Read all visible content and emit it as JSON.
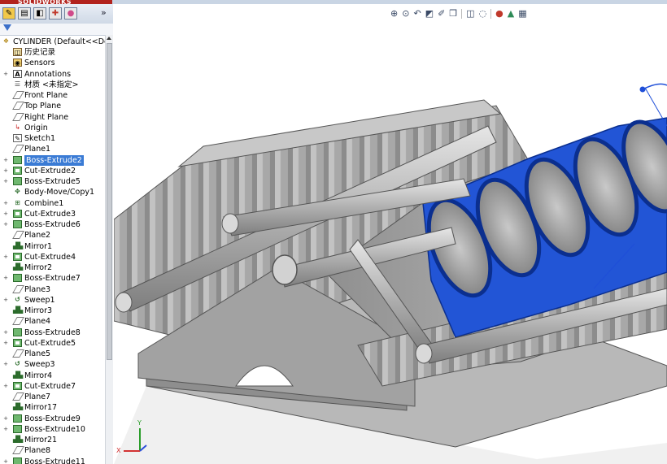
{
  "app": {
    "logo_text": "SOLIDWORKS"
  },
  "left_panel": {
    "tabs": [
      {
        "name": "feature-manager",
        "icon": "feature-tree-icon"
      },
      {
        "name": "property-manager",
        "icon": "property-icon"
      },
      {
        "name": "configuration-manager",
        "icon": "configuration-icon"
      },
      {
        "name": "dimxpert-manager",
        "icon": "dimxpert-icon"
      },
      {
        "name": "display-manager",
        "icon": "display-icon"
      }
    ],
    "expand_label": "»"
  },
  "tree": {
    "root": "CYLINDER  (Default<<Def",
    "items": [
      {
        "label": "历史记录",
        "icon": "history-icon",
        "expand": ""
      },
      {
        "label": "Sensors",
        "icon": "sensor-icon",
        "expand": ""
      },
      {
        "label": "Annotations",
        "icon": "annotations-icon",
        "expand": "+"
      },
      {
        "label": "材质 <未指定>",
        "icon": "material-icon",
        "expand": ""
      },
      {
        "label": "Front Plane",
        "icon": "plane-icon",
        "expand": ""
      },
      {
        "label": "Top Plane",
        "icon": "plane-icon",
        "expand": ""
      },
      {
        "label": "Right Plane",
        "icon": "plane-icon",
        "expand": ""
      },
      {
        "label": "Origin",
        "icon": "origin-icon",
        "expand": ""
      },
      {
        "label": "Sketch1",
        "icon": "sketch-icon",
        "expand": ""
      },
      {
        "label": "Plane1",
        "icon": "plane-icon",
        "expand": ""
      },
      {
        "label": "Boss-Extrude2",
        "icon": "boss-extrude-icon",
        "expand": "+",
        "selected": true
      },
      {
        "label": "Cut-Extrude2",
        "icon": "cut-extrude-icon",
        "expand": "+"
      },
      {
        "label": "Boss-Extrude5",
        "icon": "boss-extrude-icon",
        "expand": "+"
      },
      {
        "label": "Body-Move/Copy1",
        "icon": "move-copy-icon",
        "expand": ""
      },
      {
        "label": "Combine1",
        "icon": "combine-icon",
        "expand": "+"
      },
      {
        "label": "Cut-Extrude3",
        "icon": "cut-extrude-icon",
        "expand": "+"
      },
      {
        "label": "Boss-Extrude6",
        "icon": "boss-extrude-icon",
        "expand": "+"
      },
      {
        "label": "Plane2",
        "icon": "plane-icon",
        "expand": ""
      },
      {
        "label": "Mirror1",
        "icon": "mirror-icon",
        "expand": ""
      },
      {
        "label": "Cut-Extrude4",
        "icon": "cut-extrude-icon",
        "expand": "+"
      },
      {
        "label": "Mirror2",
        "icon": "mirror-icon",
        "expand": ""
      },
      {
        "label": "Boss-Extrude7",
        "icon": "boss-extrude-icon",
        "expand": "+"
      },
      {
        "label": "Plane3",
        "icon": "plane-icon",
        "expand": ""
      },
      {
        "label": "Sweep1",
        "icon": "sweep-icon",
        "expand": "+"
      },
      {
        "label": "Mirror3",
        "icon": "mirror-icon",
        "expand": ""
      },
      {
        "label": "Plane4",
        "icon": "plane-icon",
        "expand": ""
      },
      {
        "label": "Boss-Extrude8",
        "icon": "boss-extrude-icon",
        "expand": "+"
      },
      {
        "label": "Cut-Extrude5",
        "icon": "cut-extrude-icon",
        "expand": "+"
      },
      {
        "label": "Plane5",
        "icon": "plane-icon",
        "expand": ""
      },
      {
        "label": "Sweep3",
        "icon": "sweep-icon",
        "expand": "+"
      },
      {
        "label": "Mirror4",
        "icon": "mirror-icon",
        "expand": ""
      },
      {
        "label": "Cut-Extrude7",
        "icon": "cut-extrude-icon",
        "expand": "+"
      },
      {
        "label": "Plane7",
        "icon": "plane-icon",
        "expand": ""
      },
      {
        "label": "Mirror17",
        "icon": "mirror-icon",
        "expand": ""
      },
      {
        "label": "Boss-Extrude9",
        "icon": "boss-extrude-icon",
        "expand": "+"
      },
      {
        "label": "Boss-Extrude10",
        "icon": "boss-extrude-icon",
        "expand": "+"
      },
      {
        "label": "Mirror21",
        "icon": "mirror-icon",
        "expand": ""
      },
      {
        "label": "Plane8",
        "icon": "plane-icon",
        "expand": ""
      },
      {
        "label": "Boss-Extrude11",
        "icon": "boss-extrude-icon",
        "expand": "+"
      }
    ]
  },
  "heads_up_toolbar": [
    "zoom-to-fit-icon",
    "zoom-to-area-icon",
    "previous-view-icon",
    "section-view-icon",
    "dynamic-annotation-icon",
    "view-orientation-icon",
    "display-style-icon",
    "hide-show-items-icon",
    "edit-appearance-icon",
    "apply-scene-icon",
    "view-settings-icon"
  ],
  "triad": {
    "x": "X",
    "y": "Y"
  },
  "colors": {
    "selection": "#3a7bd5",
    "highlight_blue": "#1f4fd8",
    "model_gray": "#a6a6a6",
    "brand_red": "#b2231d"
  }
}
